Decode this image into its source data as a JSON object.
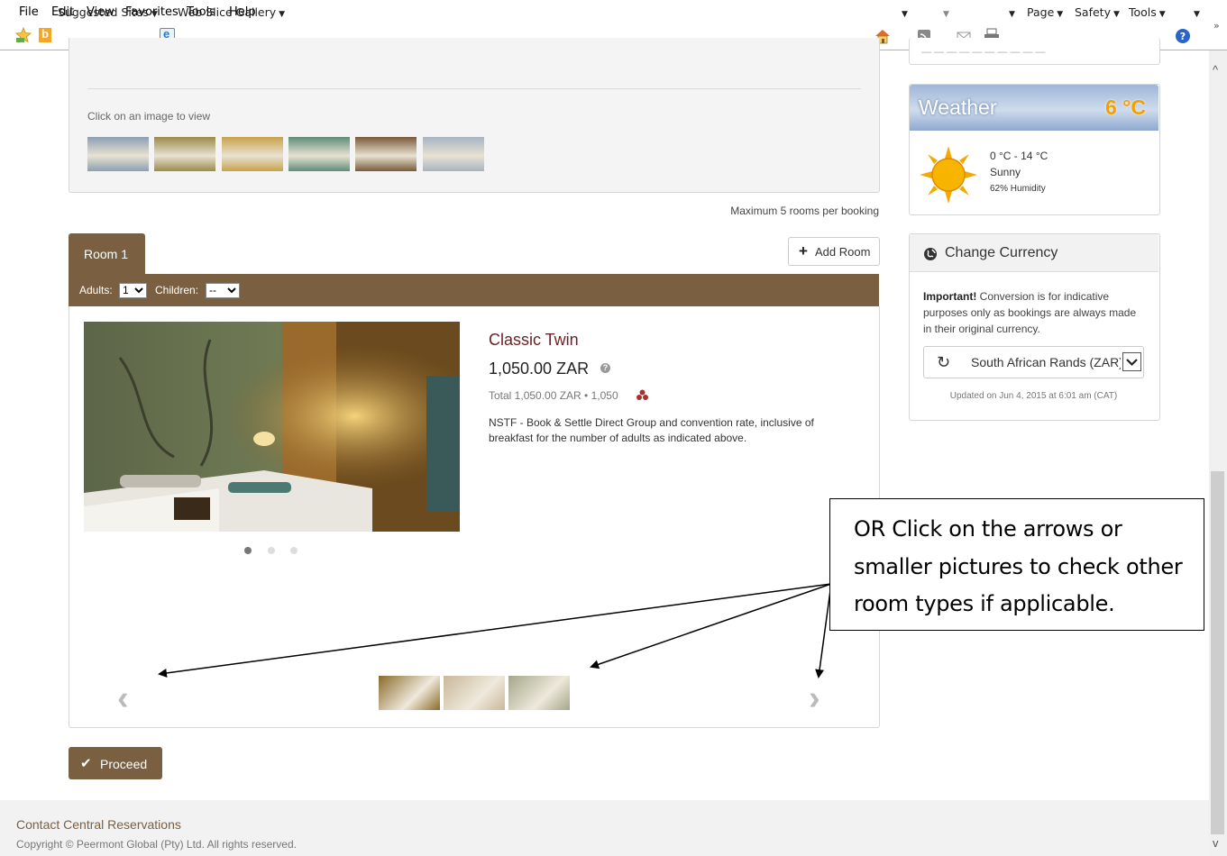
{
  "menu": [
    "File",
    "Edit",
    "View",
    "Favorites",
    "Tools",
    "Help"
  ],
  "favorites_bar": {
    "suggested_sites": "Suggested Sites",
    "web_slice_gallery": "Web Slice Gallery"
  },
  "command_bar": {
    "page": "Page",
    "safety": "Safety",
    "tools": "Tools",
    "chevron": "»"
  },
  "gallery": {
    "caption": "Click on an image to view",
    "thumbnail_colors": [
      "#8c9fb3",
      "#9c8a4a",
      "#c7a24a",
      "#5f8c7a",
      "#7a5a3a",
      "#a7b4c2"
    ]
  },
  "booking": {
    "max_rooms_note": "Maximum 5 rooms per booking",
    "room_tab": "Room 1",
    "add_room": "Add Room",
    "adults_label": "Adults:",
    "adults_value": "1",
    "children_label": "Children:",
    "children_value": "--",
    "proceed": "Proceed",
    "brand_color": "#7a6040"
  },
  "room": {
    "name": "Classic Twin",
    "price": "1,050.00 ZAR",
    "total": "Total 1,050.00 ZAR  •  1,050",
    "description": "NSTF - Book & Settle Direct Group and convention rate, inclusive of breakfast for the number of adults as indicated above.",
    "active_slide": 1,
    "slide_count": 3,
    "thumbnail_colors": [
      "#8a6a2a",
      "#c9b79a",
      "#a4a68a"
    ]
  },
  "weather": {
    "title": "Weather",
    "temp": "6 °C",
    "range": "0 °C - 14 °C",
    "condition": "Sunny",
    "humidity": "62% Humidity"
  },
  "currency": {
    "title": "Change Currency",
    "note_bold": "Important!",
    "note_text": " Conversion is for indicative purposes only as bookings are always made in their original currency.",
    "selected": "South African Rands (ZAR)",
    "updated": "Updated on Jun 4, 2015 at 6:01 am (CAT)"
  },
  "annotation": {
    "text": "OR Click on the arrows or smaller pictures to check other room types if applicable."
  },
  "footer": {
    "contact_link": "Contact Central Reservations",
    "copyright": "Copyright © Peermont Global (Pty) Ltd. All rights reserved."
  }
}
